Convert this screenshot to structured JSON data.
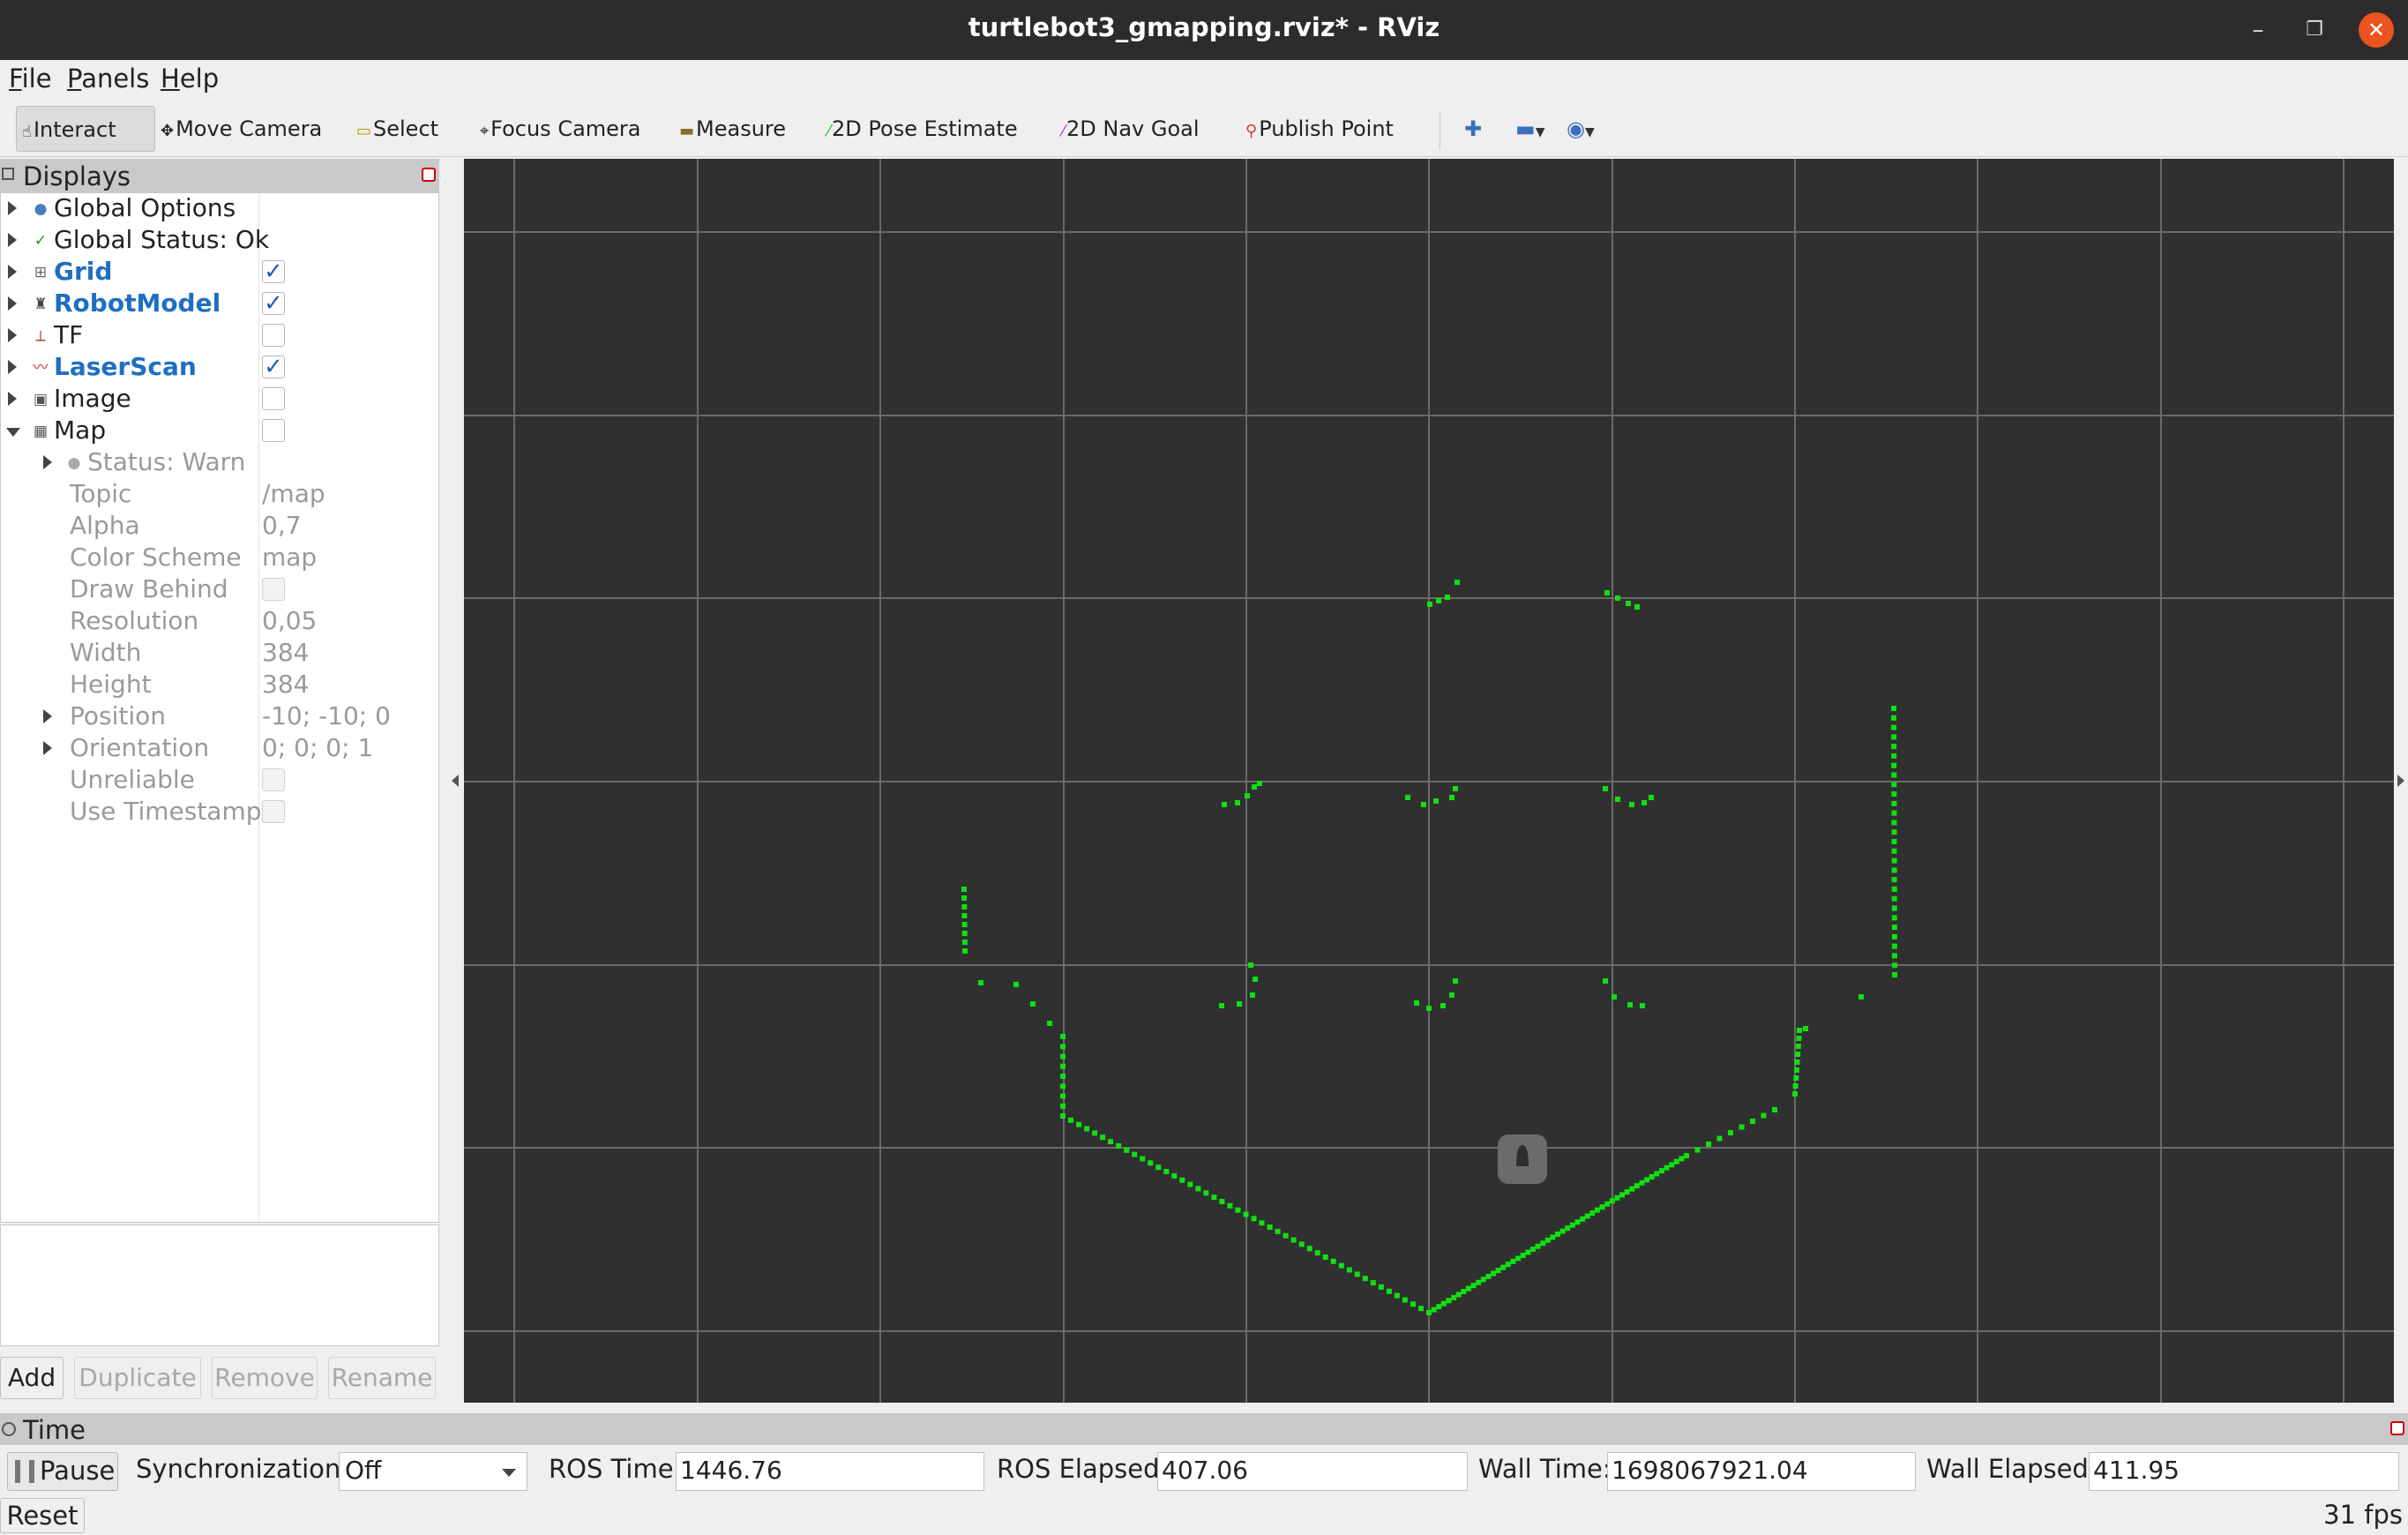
{
  "window": {
    "title": "turtlebot3_gmapping.rviz* - RViz",
    "min_icon": "minimize-icon",
    "max_icon": "maximize-icon",
    "close_icon": "close-icon"
  },
  "menu": {
    "items": [
      "File",
      "Panels",
      "Help"
    ]
  },
  "toolbar": {
    "tools": [
      {
        "label": "Interact",
        "icon": "hand-icon",
        "active": true
      },
      {
        "label": "Move Camera",
        "icon": "move-camera-icon"
      },
      {
        "label": "Select",
        "icon": "select-icon"
      },
      {
        "label": "Focus Camera",
        "icon": "focus-camera-icon"
      },
      {
        "label": "Measure",
        "icon": "ruler-icon"
      },
      {
        "label": "2D Pose Estimate",
        "icon": "pose-estimate-icon",
        "color": "#2fbf2f"
      },
      {
        "label": "2D Nav Goal",
        "icon": "nav-goal-icon",
        "color": "#c03ac0"
      },
      {
        "label": "Publish Point",
        "icon": "map-pin-icon",
        "color": "#d04020"
      }
    ],
    "extra_icons": [
      "plus-icon",
      "minus-icon",
      "eye-icon"
    ]
  },
  "displays": {
    "title": "Displays",
    "items": [
      {
        "name": "Global Options",
        "icon": "gear-icon"
      },
      {
        "name": "Global Status: Ok",
        "icon": "check-icon"
      },
      {
        "name": "Grid",
        "icon": "grid-icon",
        "checked": true,
        "highlight": true
      },
      {
        "name": "RobotModel",
        "icon": "robot-icon",
        "checked": true,
        "highlight": true
      },
      {
        "name": "TF",
        "icon": "axes-icon",
        "checked": false
      },
      {
        "name": "LaserScan",
        "icon": "laser-icon",
        "checked": true,
        "highlight": true
      },
      {
        "name": "Image",
        "icon": "image-icon",
        "checked": false
      },
      {
        "name": "Map",
        "icon": "map-icon",
        "checked": false,
        "expanded": true
      }
    ],
    "map_properties": [
      {
        "name": "Status: Warn",
        "value": ""
      },
      {
        "name": "Topic",
        "value": "/map"
      },
      {
        "name": "Alpha",
        "value": "0,7"
      },
      {
        "name": "Color Scheme",
        "value": "map"
      },
      {
        "name": "Draw Behind",
        "value": ""
      },
      {
        "name": "Resolution",
        "value": "0,05"
      },
      {
        "name": "Width",
        "value": "384"
      },
      {
        "name": "Height",
        "value": "384"
      },
      {
        "name": "Position",
        "value": "-10; -10; 0"
      },
      {
        "name": "Orientation",
        "value": "0; 0; 0; 1"
      },
      {
        "name": "Unreliable",
        "value": ""
      },
      {
        "name": "Use Timestamp",
        "value": ""
      }
    ],
    "buttons": {
      "add": "Add",
      "duplicate": "Duplicate",
      "remove": "Remove",
      "rename": "Rename"
    }
  },
  "viewport": {
    "background": "#303030",
    "grid_color": "#6a6a6a",
    "scan_color": "#11e011"
  },
  "time_panel": {
    "title": "Time",
    "pause": "Pause",
    "sync_label": "Synchronization:",
    "sync_value": "Off",
    "ros_time_label": "ROS Time:",
    "ros_time": "1446.76",
    "ros_elapsed_label": "ROS Elapsed:",
    "ros_elapsed": "407.06",
    "wall_time_label": "Wall Time:",
    "wall_time": "1698067921.04",
    "wall_elapsed_label": "Wall Elapsed:",
    "wall_elapsed": "411.95"
  },
  "footer": {
    "reset": "Reset",
    "fps": "31 fps"
  }
}
